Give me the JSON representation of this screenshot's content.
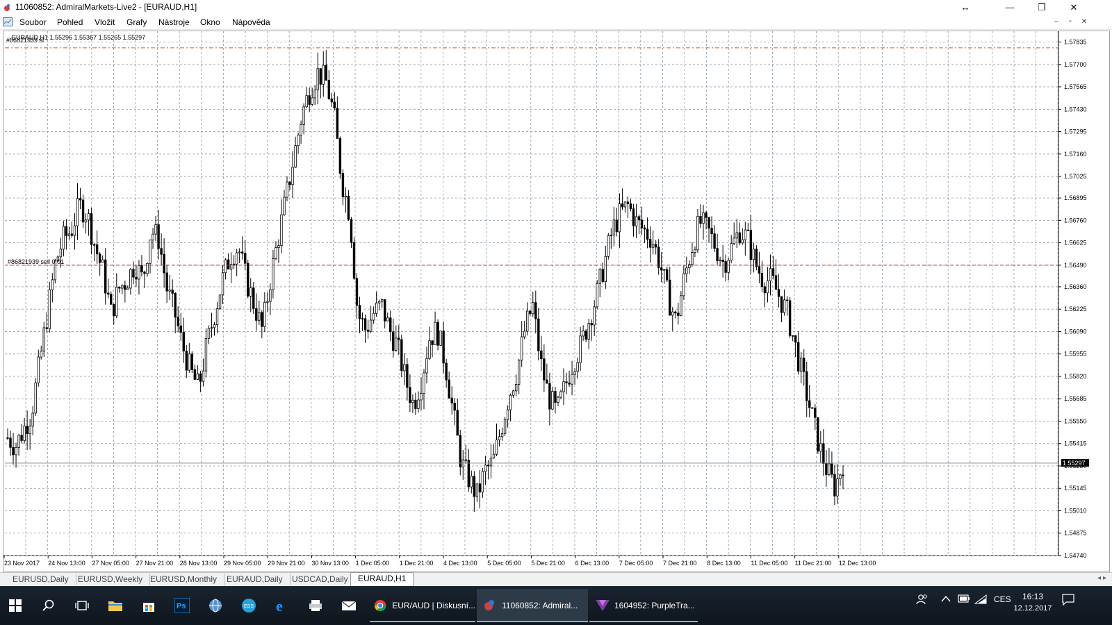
{
  "window": {
    "title": "11060852: AdmiralMarkets-Live2 - [EURAUD,H1]",
    "minimize": "—",
    "restore": "❐",
    "close": "✕",
    "resize": "↔"
  },
  "menu": {
    "items": [
      "Soubor",
      "Pohled",
      "Vložit",
      "Grafy",
      "Nástroje",
      "Okno",
      "Nápověda"
    ],
    "mdi_minimize": "–",
    "mdi_restore": "▫",
    "mdi_close": "✕"
  },
  "chart": {
    "header": "EURAUD,H1  1.55296 1.55367 1.55265 1.55297",
    "order_top_label": "#86821939 sl",
    "order_label": "#86821939 sell 0.01",
    "current_price": "1.55297",
    "top_sl_level": 1.578,
    "order_level": 1.5649,
    "price_ticks": [
      "1.57835",
      "1.57700",
      "1.57565",
      "1.57430",
      "1.57295",
      "1.57160",
      "1.57025",
      "1.56895",
      "1.56760",
      "1.56625",
      "1.56490",
      "1.56360",
      "1.56225",
      "1.56090",
      "1.55955",
      "1.55820",
      "1.55685",
      "1.55550",
      "1.55415",
      "1.55280",
      "1.55145",
      "1.55010",
      "1.54875",
      "1.54740"
    ],
    "time_ticks": [
      "23 Nov 2017",
      "24 Nov 13:00",
      "27 Nov 05:00",
      "27 Nov 21:00",
      "28 Nov 13:00",
      "29 Nov 05:00",
      "29 Nov 21:00",
      "30 Nov 13:00",
      "1 Dec 05:00",
      "1 Dec 21:00",
      "4 Dec 13:00",
      "5 Dec 05:00",
      "5 Dec 21:00",
      "6 Dec 13:00",
      "7 Dec 05:00",
      "7 Dec 21:00",
      "8 Dec 13:00",
      "11 Dec 05:00",
      "11 Dec 21:00",
      "12 Dec 13:00"
    ],
    "chart_data": {
      "type": "candlestick",
      "ylim": [
        1.5474,
        1.579
      ],
      "close_path": [
        1.5545,
        1.554,
        1.555,
        1.556,
        1.559,
        1.562,
        1.565,
        1.5665,
        1.567,
        1.5685,
        1.568,
        1.566,
        1.5645,
        1.562,
        1.5635,
        1.564,
        1.565,
        1.564,
        1.567,
        1.5665,
        1.5635,
        1.562,
        1.56,
        1.5585,
        1.5575,
        1.56,
        1.562,
        1.564,
        1.5655,
        1.566,
        1.564,
        1.5625,
        1.561,
        1.564,
        1.5665,
        1.569,
        1.5715,
        1.574,
        1.5755,
        1.5765,
        1.576,
        1.574,
        1.57,
        1.568,
        1.562,
        1.561,
        1.562,
        1.5625,
        1.561,
        1.56,
        1.558,
        1.5565,
        1.558,
        1.5605,
        1.561,
        1.559,
        1.556,
        1.553,
        1.552,
        1.551,
        1.5525,
        1.553,
        1.555,
        1.557,
        1.5585,
        1.561,
        1.5625,
        1.559,
        1.557,
        1.556,
        1.5575,
        1.559,
        1.56,
        1.5615,
        1.563,
        1.565,
        1.567,
        1.568,
        1.5685,
        1.5675,
        1.567,
        1.5665,
        1.565,
        1.563,
        1.5615,
        1.564,
        1.566,
        1.5675,
        1.567,
        1.566,
        1.565,
        1.566,
        1.567,
        1.5665,
        1.565,
        1.564,
        1.564,
        1.563,
        1.562,
        1.56,
        1.558,
        1.556,
        1.554,
        1.5525,
        1.5515,
        1.553
      ]
    }
  },
  "tabs": [
    "EURUSD,Daily",
    "EURUSD,Weekly",
    "EURUSD,Monthly",
    "EURAUD,Daily",
    "USDCAD,Daily",
    "EURAUD,H1"
  ],
  "tabs_scroll": "◂ ▸",
  "taskbar": {
    "apps": [
      {
        "label": "EUR/AUD | Diskusní..."
      },
      {
        "label": "11060852: Admiral..."
      },
      {
        "label": "1604952: PurpleTra..."
      }
    ],
    "tray_lang": "CES",
    "clock_time": "16:13",
    "clock_date": "12.12.2017"
  }
}
